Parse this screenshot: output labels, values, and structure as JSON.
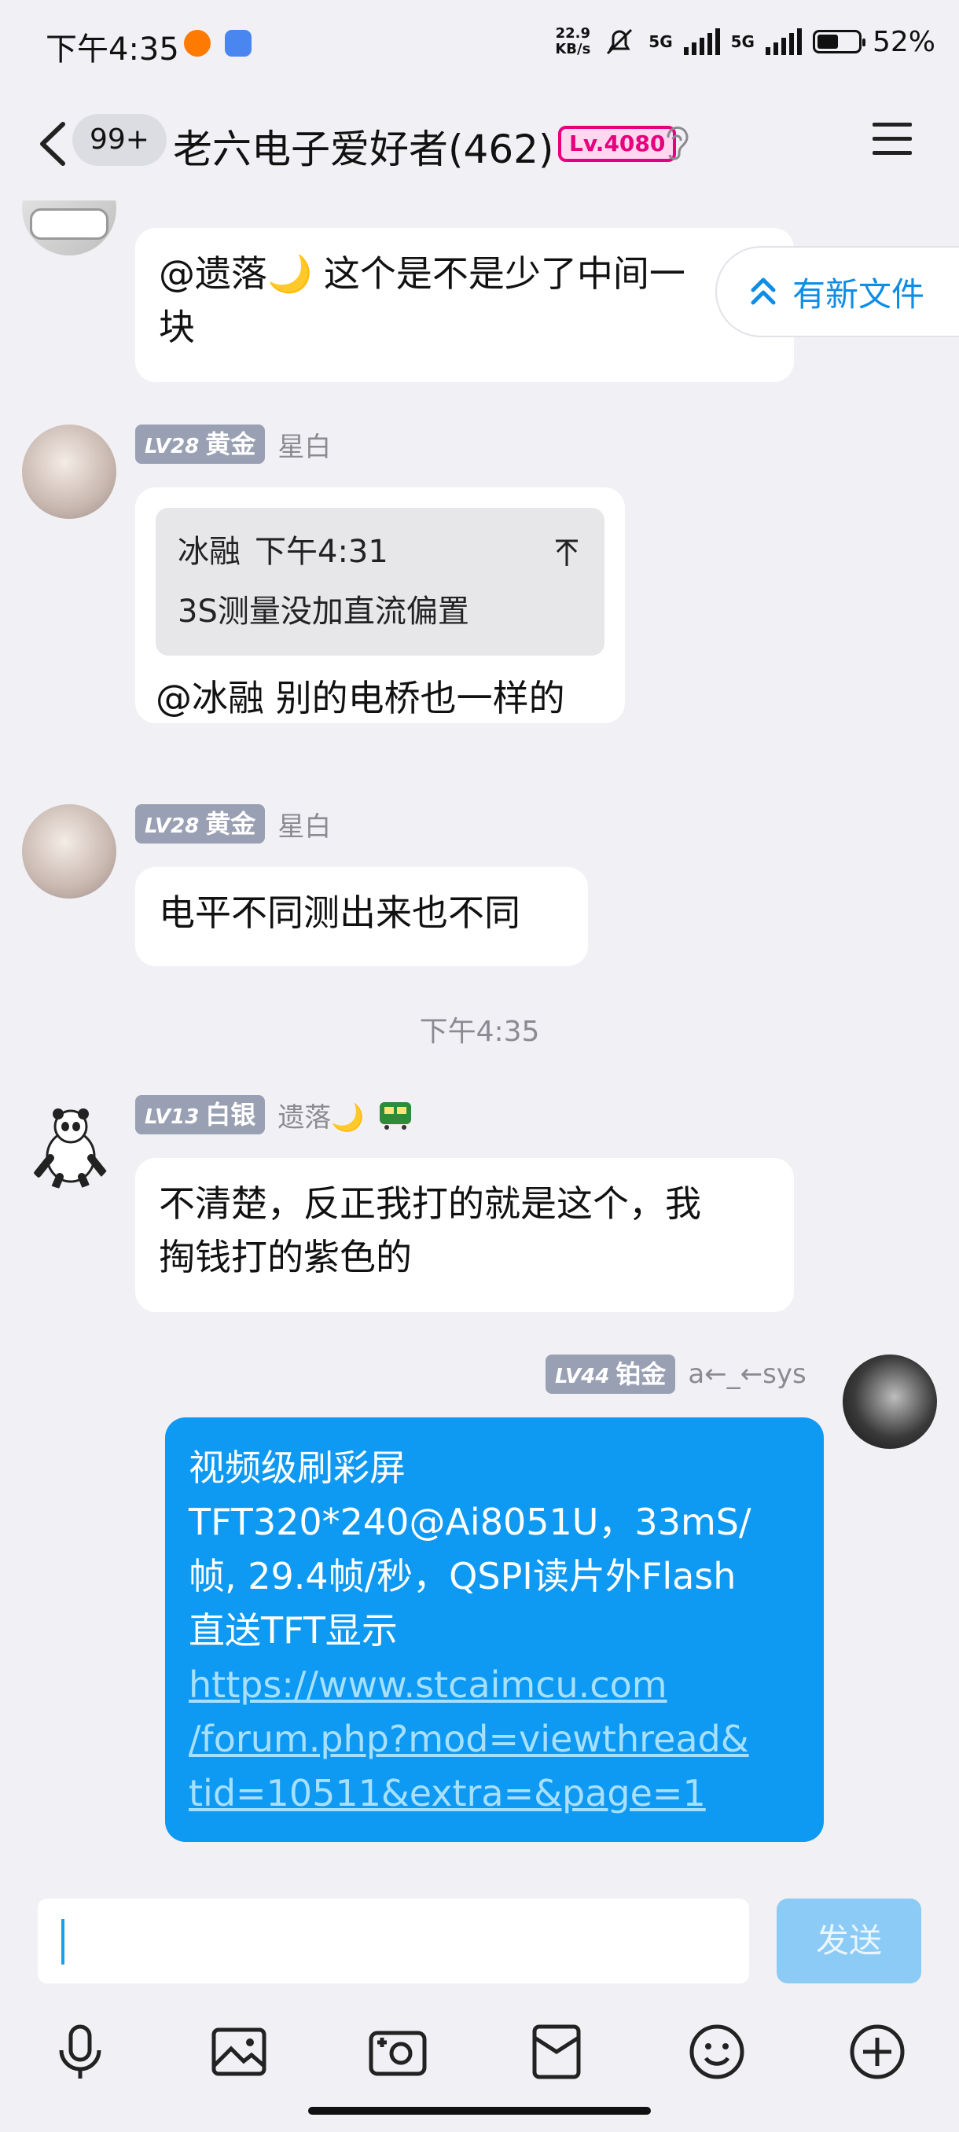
{
  "status_bar": {
    "time": "下午4:35",
    "net_speed_value": "22.9",
    "net_speed_unit": "KB/s",
    "sig1": "5G",
    "sig2": "5G",
    "battery": "52%",
    "battery_level": 0.52
  },
  "header": {
    "unread_badge": "99+",
    "group_title": "老六电子爱好者(462)",
    "level_badge": "Lv.4080"
  },
  "new_file_button": "有新文件",
  "messages": [
    {
      "text_line1": "@遗落🌙 这个是不是少了中间一",
      "text_line2": "块"
    },
    {
      "level": "LV28",
      "rank": "黄金",
      "nickname": "星白",
      "quote_author": "冰融",
      "quote_time": "下午4:31",
      "quote_text": "3S测量没加直流偏置",
      "text": "@冰融 别的电桥也一样的"
    },
    {
      "level": "LV28",
      "rank": "黄金",
      "nickname": "星白",
      "text": "电平不同测出来也不同"
    },
    {
      "separator_time": "下午4:35"
    },
    {
      "level": "LV13",
      "rank": "白银",
      "nickname": "遗落🌙",
      "text_line1": "不清楚，反正我打的就是这个，我",
      "text_line2": "掏钱打的紫色的"
    },
    {
      "level": "LV44",
      "rank": "铂金",
      "nickname": "a←_←sys",
      "text_line1": "视频级刷彩屏",
      "text_line2": "TFT320*240@Ai8051U，33mS/",
      "text_line3": "帧, 29.4帧/秒，QSPI读片外Flash",
      "text_line4": "直送TFT显示",
      "link_line1": "https://www.stcaimcu.com",
      "link_line2": "/forum.php?mod=viewthread&",
      "link_line3": "tid=10511&extra=&page=1"
    }
  ],
  "input": {
    "placeholder": "",
    "send_label": "发送"
  },
  "toolbar_icons": [
    "microphone-icon",
    "image-icon",
    "camera-icon",
    "red-packet-icon",
    "emoji-icon",
    "plus-icon"
  ]
}
